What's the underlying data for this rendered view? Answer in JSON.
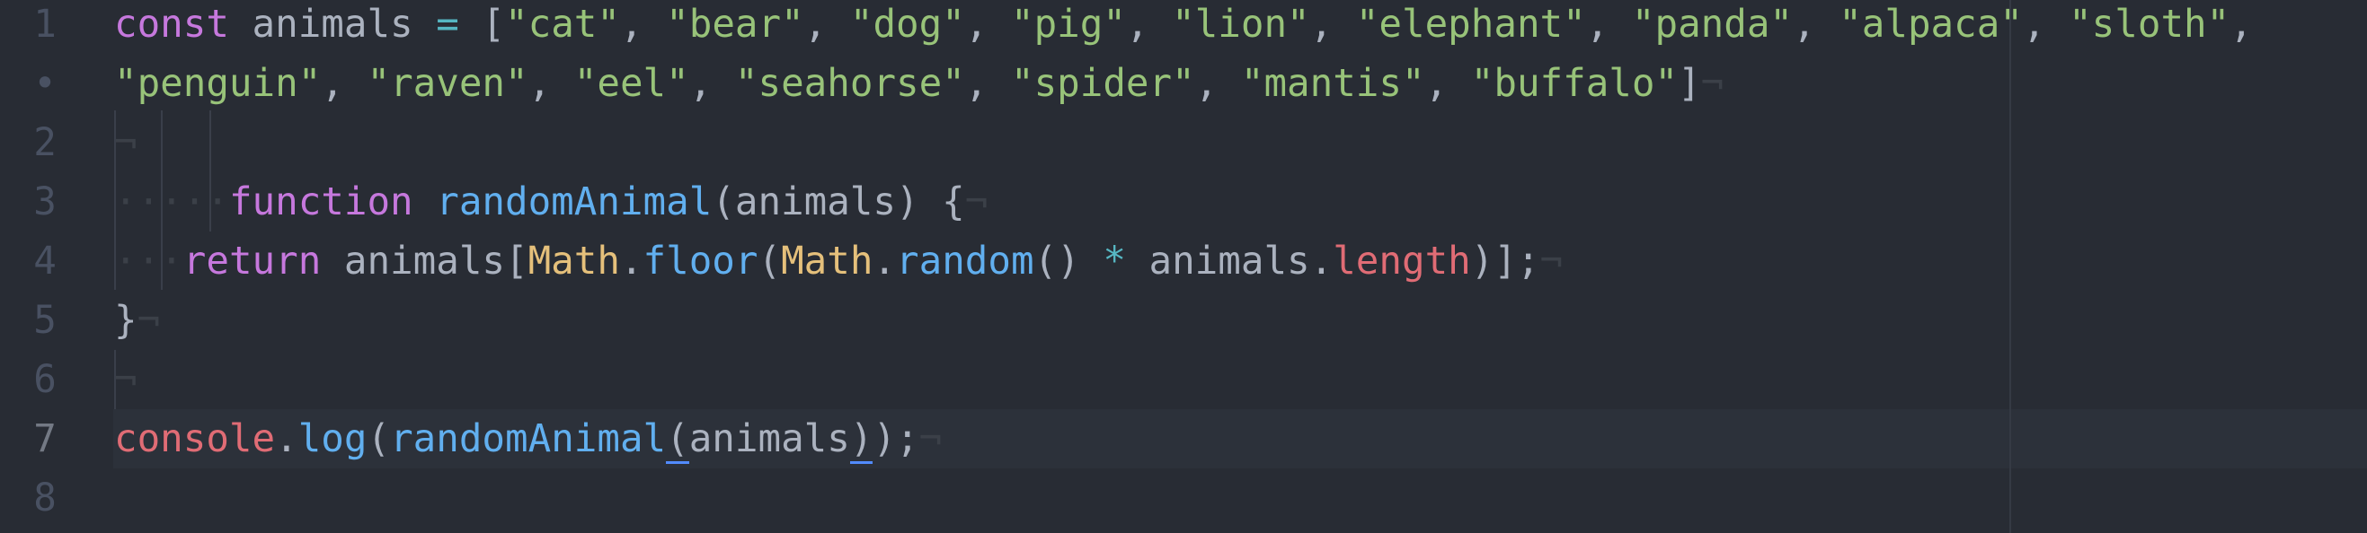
{
  "theme_colors": {
    "background": "#282c34",
    "current_line": "#2c313a",
    "bracket_match": "#528bff"
  },
  "rows": [
    {
      "gutter": "1",
      "tokens": [
        [
          "kw",
          "const"
        ],
        [
          "var",
          " animals "
        ],
        [
          "op",
          "="
        ],
        [
          "var",
          " ["
        ],
        [
          "str",
          "\"cat\""
        ],
        [
          "var",
          ", "
        ],
        [
          "str",
          "\"bear\""
        ],
        [
          "var",
          ", "
        ],
        [
          "str",
          "\"dog\""
        ],
        [
          "var",
          ", "
        ],
        [
          "str",
          "\"pig\""
        ],
        [
          "var",
          ", "
        ],
        [
          "str",
          "\"lion\""
        ],
        [
          "var",
          ", "
        ],
        [
          "str",
          "\"elephant\""
        ],
        [
          "var",
          ", "
        ],
        [
          "str",
          "\"panda\""
        ],
        [
          "var",
          ", "
        ],
        [
          "str",
          "\"alpaca\""
        ],
        [
          "var",
          ", "
        ],
        [
          "str",
          "\"sloth\""
        ],
        [
          "var",
          ","
        ]
      ]
    },
    {
      "gutter": "•",
      "tokens": [
        [
          "str",
          "\"penguin\""
        ],
        [
          "var",
          ", "
        ],
        [
          "str",
          "\"raven\""
        ],
        [
          "var",
          ", "
        ],
        [
          "str",
          "\"eel\""
        ],
        [
          "var",
          ", "
        ],
        [
          "str",
          "\"seahorse\""
        ],
        [
          "var",
          ", "
        ],
        [
          "str",
          "\"spider\""
        ],
        [
          "var",
          ", "
        ],
        [
          "str",
          "\"mantis\""
        ],
        [
          "var",
          ", "
        ],
        [
          "str",
          "\"buffalo\""
        ],
        [
          "var",
          "]"
        ],
        [
          "inv",
          "¬"
        ]
      ]
    },
    {
      "gutter": "2",
      "tokens": [
        [
          "inv",
          "¬"
        ]
      ]
    },
    {
      "gutter": "3",
      "tokens": [
        [
          "inv",
          "·····"
        ],
        [
          "kw",
          "function"
        ],
        [
          "var",
          " "
        ],
        [
          "fn",
          "randomAnimal"
        ],
        [
          "var",
          "(animals) {"
        ],
        [
          "inv",
          "¬"
        ]
      ]
    },
    {
      "gutter": "4",
      "tokens": [
        [
          "inv",
          "···"
        ],
        [
          "kw",
          "return"
        ],
        [
          "var",
          " animals["
        ],
        [
          "cls",
          "Math"
        ],
        [
          "var",
          "."
        ],
        [
          "fn",
          "floor"
        ],
        [
          "var",
          "("
        ],
        [
          "cls",
          "Math"
        ],
        [
          "var",
          "."
        ],
        [
          "fn",
          "random"
        ],
        [
          "var",
          "() "
        ],
        [
          "op",
          "*"
        ],
        [
          "var",
          " animals."
        ],
        [
          "prop",
          "length"
        ],
        [
          "var",
          ")];"
        ],
        [
          "inv",
          "¬"
        ]
      ]
    },
    {
      "gutter": "5",
      "tokens": [
        [
          "var",
          "}"
        ],
        [
          "inv",
          "¬"
        ]
      ]
    },
    {
      "gutter": "6",
      "tokens": [
        [
          "inv",
          "¬"
        ]
      ]
    },
    {
      "gutter": "7",
      "current": true,
      "tokens": [
        [
          "prop",
          "console"
        ],
        [
          "var",
          "."
        ],
        [
          "fn",
          "log"
        ],
        [
          "var",
          "("
        ],
        [
          "fn",
          "randomAnimal"
        ],
        [
          "var bm",
          "("
        ],
        [
          "var",
          "animals"
        ],
        [
          "var bm",
          ")"
        ],
        [
          "var",
          ");"
        ],
        [
          "inv",
          "¬"
        ]
      ]
    },
    {
      "gutter": "8",
      "tokens": []
    }
  ]
}
